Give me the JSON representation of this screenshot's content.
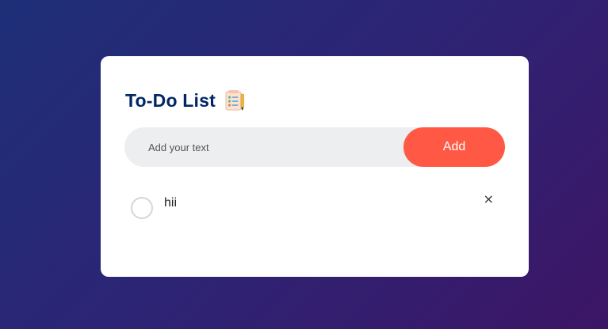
{
  "app": {
    "title": "To-Do List",
    "title_icon": "checklist-notepad-icon"
  },
  "input": {
    "placeholder": "Add your text",
    "value": "",
    "add_label": "Add"
  },
  "tasks": [
    {
      "text": "hii",
      "checked": false,
      "remove_glyph": "×"
    }
  ],
  "colors": {
    "title": "#002765",
    "accent": "#ff5945",
    "input_bg": "#edeef0",
    "bg_start": "#1e2f78",
    "bg_end": "#3d1566"
  }
}
